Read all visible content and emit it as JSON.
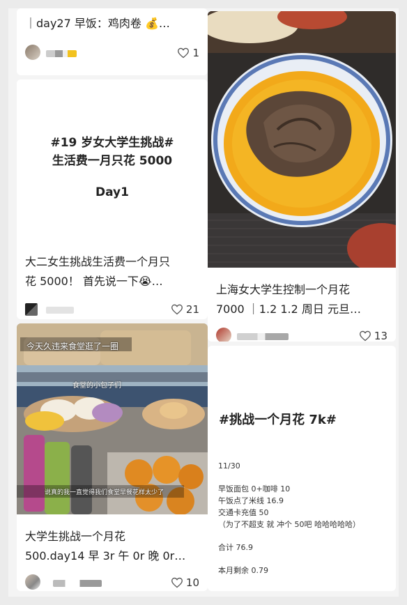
{
  "cards": [
    {
      "title": "｜day27 早饭：鸡肉卷 💰…",
      "likes": "1"
    },
    {
      "cover_hashtag": "#19 岁女大学生挑战#",
      "cover_line2": "生活费一月只花 5000",
      "cover_day": "Day1",
      "title_line1": "大二女生挑战生活费一个月只",
      "title_line2": "花 5000！ 首先说一下😭…",
      "likes": "21"
    },
    {
      "title_line1": "上海女大学生控制一个月花",
      "title_line2": "7000 ｜1.2 1.2 周日 元旦…",
      "likes": "13"
    },
    {
      "overlay_top": "今天久违来食堂逛了一圈",
      "overlay_mid": "食堂的小包子们",
      "overlay_bottom": "说真的我一直觉得我们食堂早餐花样太少了",
      "title_line1": "大学生挑战一个月花",
      "title_line2": "500.day14 早 3r 午 0r 晚 0r…",
      "likes": "10"
    },
    {
      "heading": "#挑战一个月花 7k#",
      "date": "11/30",
      "lines": [
        "早饭面包 0+咖啡 10",
        "午饭点了米线 16.9",
        "交通卡充值 50",
        "（为了不超支 就 冲个 50吧 哈哈哈哈哈）"
      ],
      "total": "合计 76.9",
      "remaining": "本月剩余 0.79"
    }
  ],
  "icons": {
    "like": "heart-outline-icon",
    "money": "money-bag-icon"
  },
  "colors": {
    "yolk": "#f2a91a",
    "bowl_rim": "#5a79b5",
    "blurred_name": "#d9d9d9"
  }
}
